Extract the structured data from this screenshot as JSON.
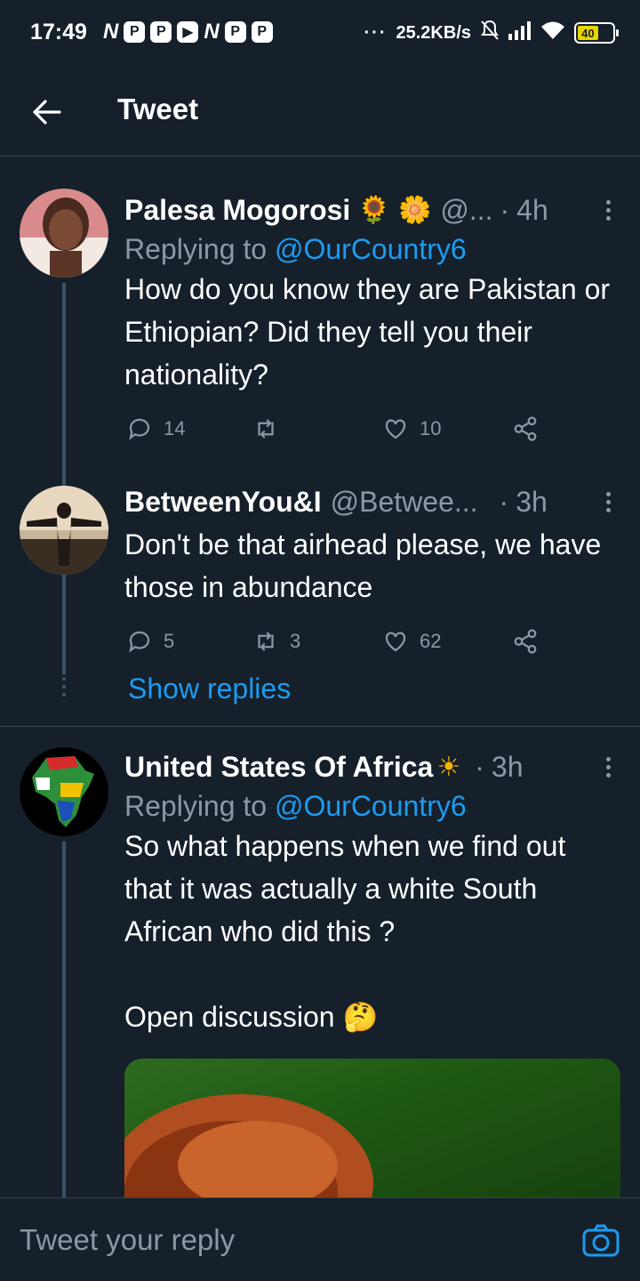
{
  "status_bar": {
    "time": "17:49",
    "notif_icons": [
      "N",
      "P",
      "P",
      "▶",
      "N",
      "P",
      "P"
    ],
    "network_speed": "25.2KB/s",
    "battery": "40"
  },
  "header": {
    "title": "Tweet"
  },
  "tweets": [
    {
      "name": "Palesa Mogorosi",
      "emojis": "🌻 🌼",
      "handle": "@...",
      "dot": "·",
      "time": "4h",
      "reply_prefix": "Replying to ",
      "reply_to": "@OurCountry6",
      "text": "How do you know they are Pakistan or Ethiopian? Did they tell you their nationality?",
      "replies": "14",
      "retweets": "",
      "likes": "10"
    },
    {
      "name": "BetweenYou&I",
      "handle": "@Betwee...",
      "dot": "·",
      "time": "3h",
      "text": "Don't be that airhead please, we have those in abundance",
      "replies": "5",
      "retweets": "3",
      "likes": "62"
    },
    {
      "name": "United States Of Africa",
      "emojis": "☀",
      "dot": "·",
      "time": "3h",
      "reply_prefix": "Replying to ",
      "reply_to": "@OurCountry6",
      "text": "So what happens when we find out that it was actually a white South African who did this ?\n\nOpen discussion 🤔"
    }
  ],
  "show_replies": "Show replies",
  "reply_bar": {
    "placeholder": "Tweet your reply"
  },
  "colors": {
    "background": "#15202b",
    "accent": "#1d9bf0",
    "muted": "#8b98a5",
    "divider": "#38444d"
  }
}
